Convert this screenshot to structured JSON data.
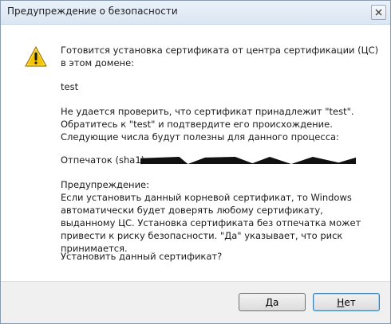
{
  "window": {
    "title": "Предупреждение о безопасности"
  },
  "message": {
    "intro": "Готовится установка сертификата от центра сертификации (ЦС) в этом домене:",
    "subject": "test",
    "verify": "Не удается проверить, что сертификат принадлежит \"test\". Обратитесь к \"test\" и подтвердите его происхождение. Следующие числа будут полезны для данного процесса:",
    "thumbprint_label": "Отпечаток (sha1) :",
    "warning": "Предупреждение:\nЕсли установить данный корневой сертификат, то Windows автоматически будет доверять любому сертификату, выданному ЦС. Установка сертификата без отпечатка может привести к риску безопасности. \"Да\" указывает, что риск принимается.",
    "question": "Установить данный сертификат?"
  },
  "buttons": {
    "yes": "Да",
    "no": "Нет"
  },
  "icons": {
    "warning": "warning-triangle-icon",
    "close": "close-icon"
  },
  "colors": {
    "warning_fill": "#f2c500",
    "footer_bg": "#f0f0f0",
    "default_button_border": "#3c7fb1"
  }
}
